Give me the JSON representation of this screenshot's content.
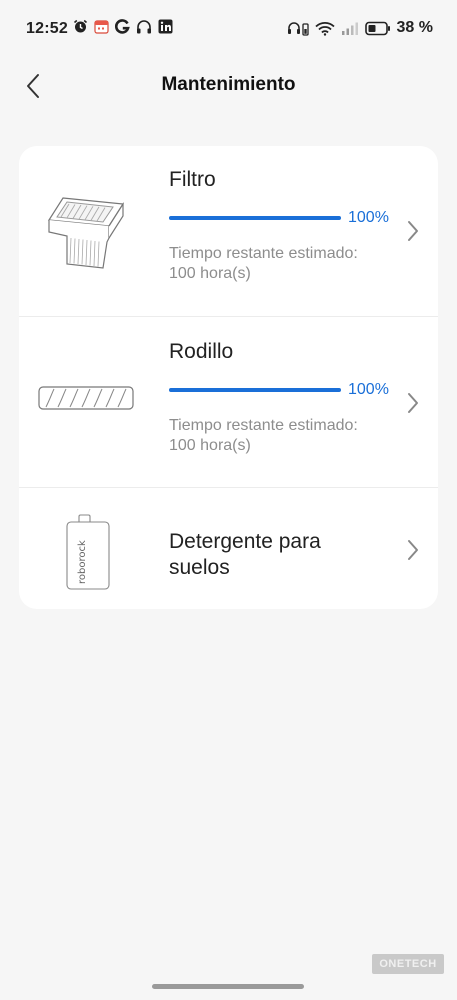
{
  "status_bar": {
    "time": "12:52",
    "battery": "38 %",
    "left_icons": [
      "alarm-icon",
      "calendar-icon",
      "g-app-icon",
      "headphones-icon",
      "linkedin-icon"
    ],
    "right_icons": [
      "earbuds-icon",
      "wifi-icon",
      "signal-icon",
      "battery-icon"
    ]
  },
  "header": {
    "title": "Mantenimiento",
    "back_icon": "chevron-left-icon"
  },
  "items": [
    {
      "name": "Filtro",
      "progress": 1.0,
      "percent": "100%",
      "meta_line1": "Tiempo restante estimado:",
      "meta_line2": "100 hora(s)",
      "icon": "filter-icon"
    },
    {
      "name": "Rodillo",
      "progress": 1.0,
      "percent": "100%",
      "meta_line1": "Tiempo restante estimado:",
      "meta_line2": "100 hora(s)",
      "icon": "roller-icon"
    },
    {
      "name_line1": "Detergente para",
      "name_line2": "suelos",
      "icon": "detergent-bottle-icon",
      "bottle_label": "roborock"
    }
  ],
  "watermark": "ONETECH",
  "colors": {
    "accent": "#1a6fd8",
    "track": "#dde8f7",
    "background": "#f6f6f6",
    "card": "#ffffff"
  }
}
